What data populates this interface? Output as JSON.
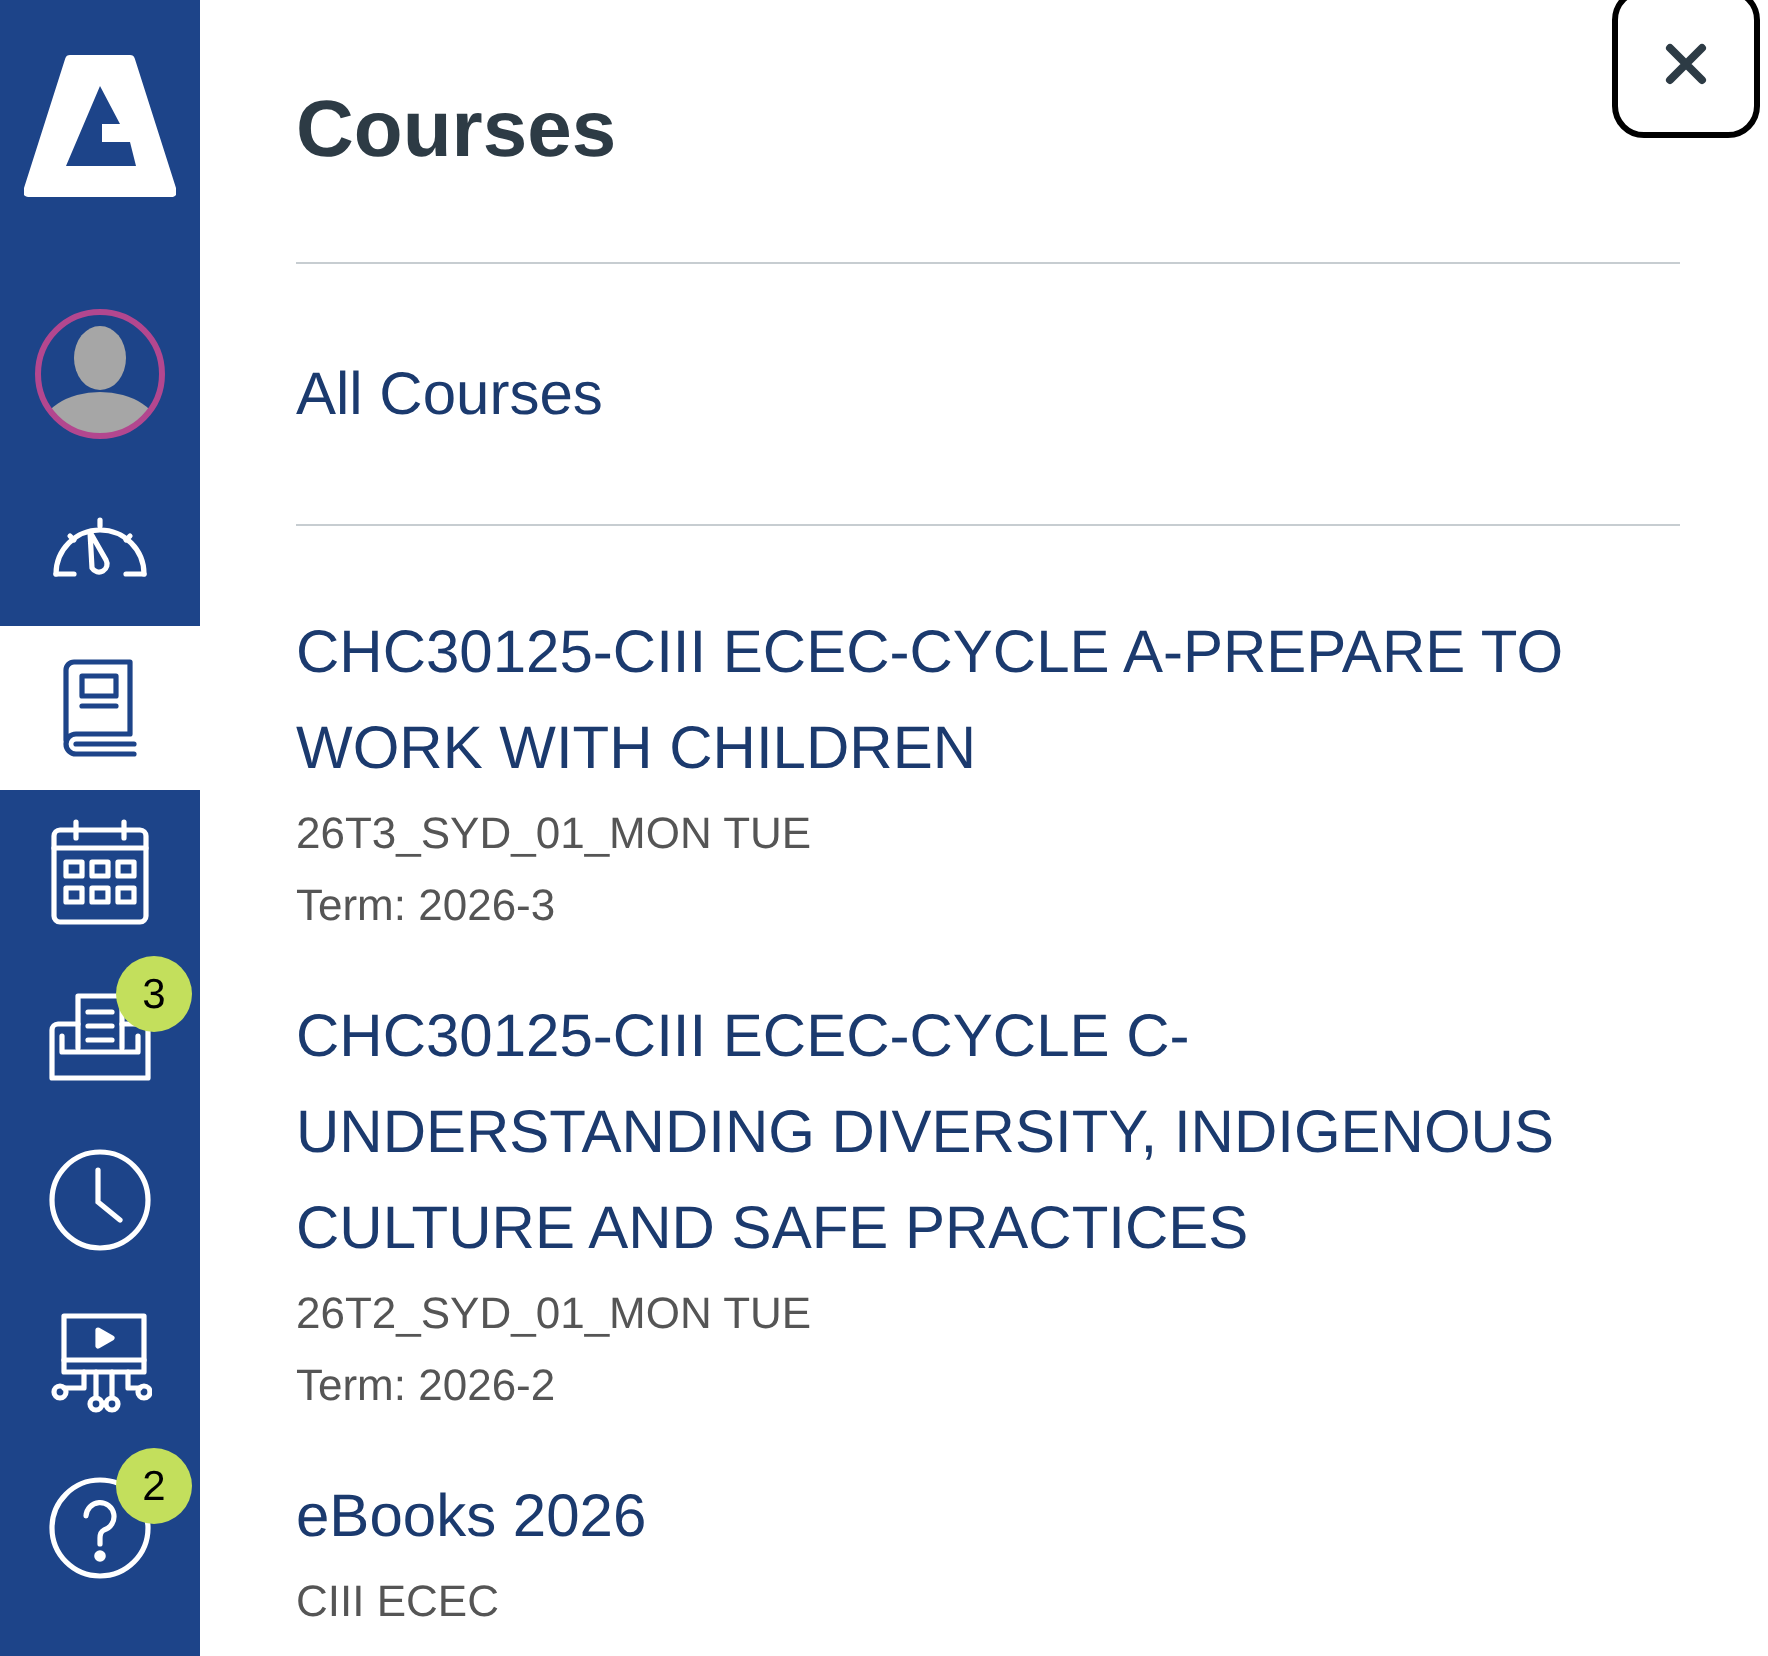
{
  "sidebar": {
    "items": [
      {
        "kind": "account",
        "selected": false
      },
      {
        "kind": "dashboard",
        "selected": false
      },
      {
        "kind": "courses",
        "selected": true
      },
      {
        "kind": "calendar",
        "selected": false
      },
      {
        "kind": "inbox",
        "selected": false,
        "badge": "3"
      },
      {
        "kind": "history",
        "selected": false
      },
      {
        "kind": "commons",
        "selected": false
      },
      {
        "kind": "help",
        "selected": false,
        "badge": "2"
      }
    ]
  },
  "tray": {
    "title": "Courses",
    "all_link": "All Courses",
    "courses": [
      {
        "title": "CHC30125-CIII ECEC-CYCLE A-PREPARE TO WORK WITH CHILDREN",
        "section": "26T3_SYD_01_MON TUE",
        "term": "Term: 2026-3"
      },
      {
        "title": "CHC30125-CIII ECEC-CYCLE C-UNDERSTANDING DIVERSITY, INDIGENOUS CULTURE AND SAFE PRACTICES",
        "section": "26T2_SYD_01_MON TUE",
        "term": "Term: 2026-2"
      },
      {
        "title": "eBooks 2026",
        "section": "CIII ECEC"
      }
    ]
  }
}
